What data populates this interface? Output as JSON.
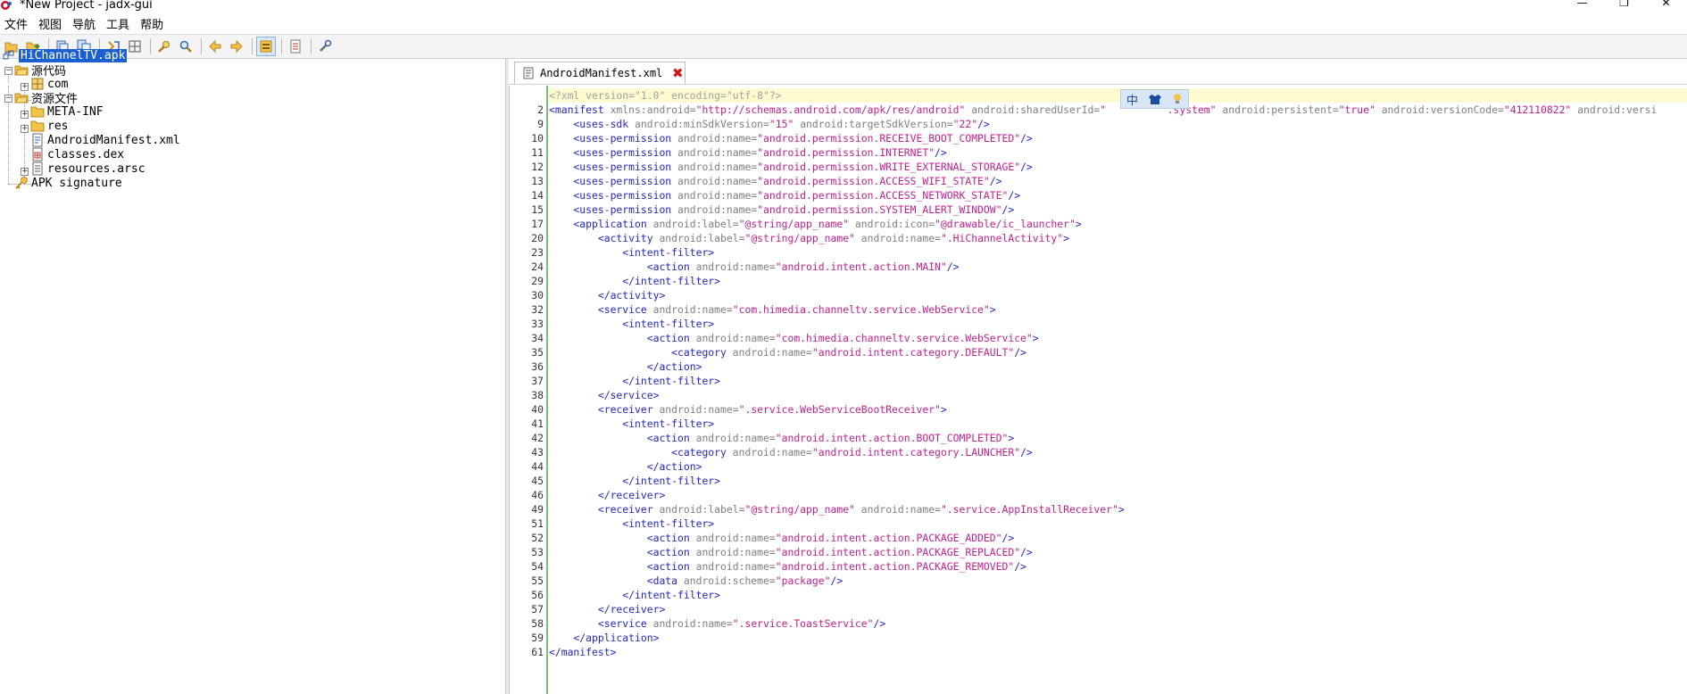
{
  "window": {
    "title": "*New Project - jadx-gui",
    "min": "—",
    "max": "❐",
    "close": "✕"
  },
  "menu": [
    "文件",
    "视图",
    "导航",
    "工具",
    "帮助"
  ],
  "colors": {
    "selection": "#1c5fd1",
    "tag": "#2626c2",
    "attr": "#808080",
    "value": "#c0208f",
    "gutter_bar": "#79c179",
    "highlight_line": "#fffbd0"
  },
  "toolbar": {
    "icons": [
      "open-folder-icon",
      "add-file-icon",
      "copy-icon",
      "copy-all-icon",
      "sync-icon",
      "tree-icon",
      "search-icon",
      "find-icon",
      "back-icon",
      "forward-icon",
      "preferences-icon",
      "log-icon",
      "tools-icon"
    ]
  },
  "tree": {
    "root": "HiChannelTV.apk",
    "source_folder": "源代码",
    "package": "com",
    "resources_folder": "资源文件",
    "meta_inf": "META-INF",
    "res": "res",
    "manifest": "AndroidManifest.xml",
    "dex": "classes.dex",
    "arsc": "resources.arsc",
    "signature": "APK signature"
  },
  "tab": {
    "label": "AndroidManifest.xml",
    "close": "✖"
  },
  "ime": {
    "mode": "中",
    "icon1": "shirt-icon",
    "icon2": "settings-bulb-icon"
  },
  "editor": {
    "lines": [
      {
        "n": "",
        "parts": [
          [
            "p",
            "<?xml version=\"1.0\" encoding=\"utf-8\"?>"
          ]
        ]
      },
      {
        "n": "2",
        "parts": [
          [
            "t",
            "<manifest "
          ],
          [
            "a",
            "xmlns:android="
          ],
          [
            "v",
            "\"http://schemas.android.com/apk/res/android\" "
          ],
          [
            "a",
            "android:sharedUserId="
          ],
          [
            "v",
            "\"          .system\" "
          ],
          [
            "a",
            "android:persistent="
          ],
          [
            "v",
            "\"true\" "
          ],
          [
            "a",
            "android:versionCode="
          ],
          [
            "v",
            "\"412110822\" "
          ],
          [
            "a",
            "android:versi"
          ]
        ]
      },
      {
        "n": "9",
        "parts": [
          [
            "t",
            "    <uses-sdk "
          ],
          [
            "a",
            "android:minSdkVersion="
          ],
          [
            "v",
            "\"15\" "
          ],
          [
            "a",
            "android:targetSdkVersion="
          ],
          [
            "v",
            "\"22\""
          ],
          [
            "t",
            "/>"
          ]
        ]
      },
      {
        "n": "10",
        "parts": [
          [
            "t",
            "    <uses-permission "
          ],
          [
            "a",
            "android:name="
          ],
          [
            "v",
            "\"android.permission.RECEIVE_BOOT_COMPLETED\""
          ],
          [
            "t",
            "/>"
          ]
        ]
      },
      {
        "n": "11",
        "parts": [
          [
            "t",
            "    <uses-permission "
          ],
          [
            "a",
            "android:name="
          ],
          [
            "v",
            "\"android.permission.INTERNET\""
          ],
          [
            "t",
            "/>"
          ]
        ]
      },
      {
        "n": "12",
        "parts": [
          [
            "t",
            "    <uses-permission "
          ],
          [
            "a",
            "android:name="
          ],
          [
            "v",
            "\"android.permission.WRITE_EXTERNAL_STORAGE\""
          ],
          [
            "t",
            "/>"
          ]
        ]
      },
      {
        "n": "13",
        "parts": [
          [
            "t",
            "    <uses-permission "
          ],
          [
            "a",
            "android:name="
          ],
          [
            "v",
            "\"android.permission.ACCESS_WIFI_STATE\""
          ],
          [
            "t",
            "/>"
          ]
        ]
      },
      {
        "n": "14",
        "parts": [
          [
            "t",
            "    <uses-permission "
          ],
          [
            "a",
            "android:name="
          ],
          [
            "v",
            "\"android.permission.ACCESS_NETWORK_STATE\""
          ],
          [
            "t",
            "/>"
          ]
        ]
      },
      {
        "n": "15",
        "parts": [
          [
            "t",
            "    <uses-permission "
          ],
          [
            "a",
            "android:name="
          ],
          [
            "v",
            "\"android.permission.SYSTEM_ALERT_WINDOW\""
          ],
          [
            "t",
            "/>"
          ]
        ]
      },
      {
        "n": "17",
        "parts": [
          [
            "t",
            "    <application "
          ],
          [
            "a",
            "android:label="
          ],
          [
            "v",
            "\"@string/app_name\" "
          ],
          [
            "a",
            "android:icon="
          ],
          [
            "v",
            "\"@drawable/ic_launcher\""
          ],
          [
            "t",
            ">"
          ]
        ]
      },
      {
        "n": "20",
        "parts": [
          [
            "t",
            "        <activity "
          ],
          [
            "a",
            "android:label="
          ],
          [
            "v",
            "\"@string/app_name\" "
          ],
          [
            "a",
            "android:name="
          ],
          [
            "v",
            "\".HiChannelActivity\""
          ],
          [
            "t",
            ">"
          ]
        ]
      },
      {
        "n": "23",
        "parts": [
          [
            "t",
            "            <intent-filter>"
          ]
        ]
      },
      {
        "n": "24",
        "parts": [
          [
            "t",
            "                <action "
          ],
          [
            "a",
            "android:name="
          ],
          [
            "v",
            "\"android.intent.action.MAIN\""
          ],
          [
            "t",
            "/>"
          ]
        ]
      },
      {
        "n": "29",
        "parts": [
          [
            "t",
            "            </intent-filter>"
          ]
        ]
      },
      {
        "n": "30",
        "parts": [
          [
            "t",
            "        </activity>"
          ]
        ]
      },
      {
        "n": "32",
        "parts": [
          [
            "t",
            "        <service "
          ],
          [
            "a",
            "android:name="
          ],
          [
            "v",
            "\"com.himedia.channeltv.service.WebService\""
          ],
          [
            "t",
            ">"
          ]
        ]
      },
      {
        "n": "33",
        "parts": [
          [
            "t",
            "            <intent-filter>"
          ]
        ]
      },
      {
        "n": "34",
        "parts": [
          [
            "t",
            "                <action "
          ],
          [
            "a",
            "android:name="
          ],
          [
            "v",
            "\"com.himedia.channeltv.service.WebService\""
          ],
          [
            "t",
            ">"
          ]
        ]
      },
      {
        "n": "35",
        "parts": [
          [
            "t",
            "                    <category "
          ],
          [
            "a",
            "android:name="
          ],
          [
            "v",
            "\"android.intent.category.DEFAULT\""
          ],
          [
            "t",
            "/>"
          ]
        ]
      },
      {
        "n": "36",
        "parts": [
          [
            "t",
            "                </action>"
          ]
        ]
      },
      {
        "n": "37",
        "parts": [
          [
            "t",
            "            </intent-filter>"
          ]
        ]
      },
      {
        "n": "38",
        "parts": [
          [
            "t",
            "        </service>"
          ]
        ]
      },
      {
        "n": "40",
        "parts": [
          [
            "t",
            "        <receiver "
          ],
          [
            "a",
            "android:name="
          ],
          [
            "v",
            "\".service.WebServiceBootReceiver\""
          ],
          [
            "t",
            ">"
          ]
        ]
      },
      {
        "n": "41",
        "parts": [
          [
            "t",
            "            <intent-filter>"
          ]
        ]
      },
      {
        "n": "42",
        "parts": [
          [
            "t",
            "                <action "
          ],
          [
            "a",
            "android:name="
          ],
          [
            "v",
            "\"android.intent.action.BOOT_COMPLETED\""
          ],
          [
            "t",
            ">"
          ]
        ]
      },
      {
        "n": "43",
        "parts": [
          [
            "t",
            "                    <category "
          ],
          [
            "a",
            "android:name="
          ],
          [
            "v",
            "\"android.intent.category.LAUNCHER\""
          ],
          [
            "t",
            "/>"
          ]
        ]
      },
      {
        "n": "44",
        "parts": [
          [
            "t",
            "                </action>"
          ]
        ]
      },
      {
        "n": "45",
        "parts": [
          [
            "t",
            "            </intent-filter>"
          ]
        ]
      },
      {
        "n": "46",
        "parts": [
          [
            "t",
            "        </receiver>"
          ]
        ]
      },
      {
        "n": "49",
        "parts": [
          [
            "t",
            "        <receiver "
          ],
          [
            "a",
            "android:label="
          ],
          [
            "v",
            "\"@string/app_name\" "
          ],
          [
            "a",
            "android:name="
          ],
          [
            "v",
            "\".service.AppInstallReceiver\""
          ],
          [
            "t",
            ">"
          ]
        ]
      },
      {
        "n": "51",
        "parts": [
          [
            "t",
            "            <intent-filter>"
          ]
        ]
      },
      {
        "n": "52",
        "parts": [
          [
            "t",
            "                <action "
          ],
          [
            "a",
            "android:name="
          ],
          [
            "v",
            "\"android.intent.action.PACKAGE_ADDED\""
          ],
          [
            "t",
            "/>"
          ]
        ]
      },
      {
        "n": "53",
        "parts": [
          [
            "t",
            "                <action "
          ],
          [
            "a",
            "android:name="
          ],
          [
            "v",
            "\"android.intent.action.PACKAGE_REPLACED\""
          ],
          [
            "t",
            "/>"
          ]
        ]
      },
      {
        "n": "54",
        "parts": [
          [
            "t",
            "                <action "
          ],
          [
            "a",
            "android:name="
          ],
          [
            "v",
            "\"android.intent.action.PACKAGE_REMOVED\""
          ],
          [
            "t",
            "/>"
          ]
        ]
      },
      {
        "n": "55",
        "parts": [
          [
            "t",
            "                <data "
          ],
          [
            "a",
            "android:scheme="
          ],
          [
            "v",
            "\"package\""
          ],
          [
            "t",
            "/>"
          ]
        ]
      },
      {
        "n": "56",
        "parts": [
          [
            "t",
            "            </intent-filter>"
          ]
        ]
      },
      {
        "n": "57",
        "parts": [
          [
            "t",
            "        </receiver>"
          ]
        ]
      },
      {
        "n": "58",
        "parts": [
          [
            "t",
            "        <service "
          ],
          [
            "a",
            "android:name="
          ],
          [
            "v",
            "\".service.ToastService\""
          ],
          [
            "t",
            "/>"
          ]
        ]
      },
      {
        "n": "59",
        "parts": [
          [
            "t",
            "    </application>"
          ]
        ]
      },
      {
        "n": "61",
        "parts": [
          [
            "t",
            "</manifest>"
          ]
        ]
      }
    ]
  }
}
